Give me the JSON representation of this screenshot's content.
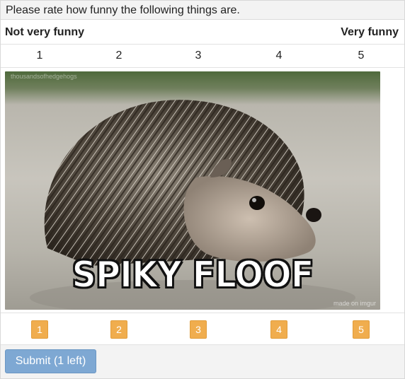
{
  "prompt": "Please rate how funny the following things are.",
  "scale": {
    "low_label": "Not very funny",
    "high_label": "Very funny",
    "numbers": [
      "1",
      "2",
      "3",
      "4",
      "5"
    ]
  },
  "item": {
    "caption": "SPIKY FLOOF",
    "watermark_top": "thousandsofhedgehogs",
    "watermark_bottom": "made on imgur"
  },
  "rating_buttons": [
    "1",
    "2",
    "3",
    "4",
    "5"
  ],
  "submit": {
    "label": "Submit (1 left)"
  },
  "colors": {
    "rating_button": "#f0ad4e",
    "submit_button": "#7ea8d3",
    "header_bg": "#f3f3f3"
  }
}
